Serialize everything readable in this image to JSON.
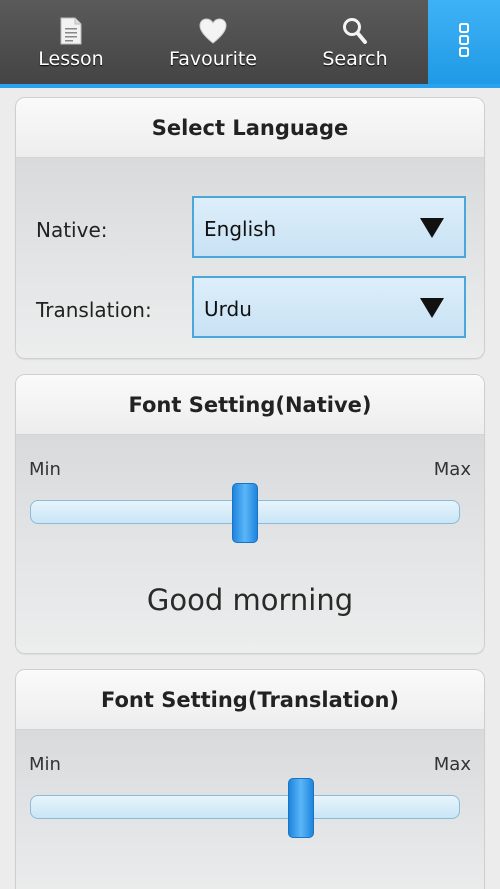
{
  "toolbar": {
    "tabs": [
      {
        "label": "Lesson",
        "icon": "document-icon"
      },
      {
        "label": "Favourite",
        "icon": "heart-icon"
      },
      {
        "label": "Search",
        "icon": "search-icon"
      }
    ],
    "menu_icon": "overflow-menu-icon",
    "accent": "#29a3ef"
  },
  "language_card": {
    "title": "Select Language",
    "native_label": "Native:",
    "native_value": "English",
    "translation_label": "Translation:",
    "translation_value": "Urdu"
  },
  "font_native_card": {
    "title": "Font Setting(Native)",
    "min_label": "Min",
    "max_label": "Max",
    "slider_fraction": 0.5,
    "preview_text": "Good morning"
  },
  "font_translation_card": {
    "title": "Font Setting(Translation)",
    "min_label": "Min",
    "max_label": "Max",
    "slider_fraction": 0.63
  }
}
